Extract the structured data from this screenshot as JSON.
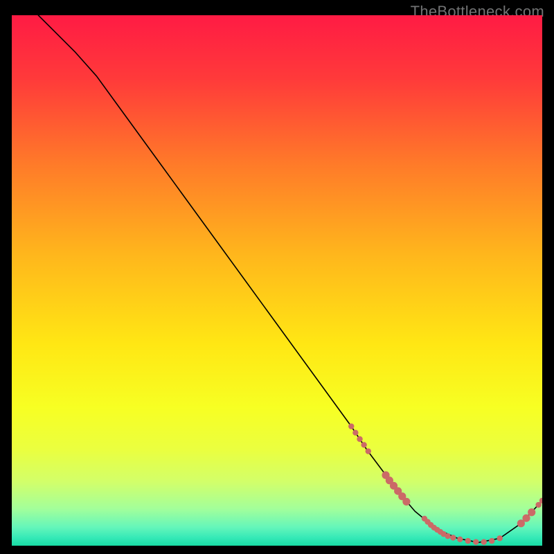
{
  "watermark": "TheBottleneck.com",
  "chart_data": {
    "type": "line",
    "title": "",
    "xlabel": "",
    "ylabel": "",
    "xlim": [
      0,
      100
    ],
    "ylim": [
      0,
      100
    ],
    "grid": false,
    "legend": false,
    "gradient_stops": [
      {
        "offset": 0.0,
        "color": "#ff1b44"
      },
      {
        "offset": 0.12,
        "color": "#ff3a3a"
      },
      {
        "offset": 0.28,
        "color": "#ff7a29"
      },
      {
        "offset": 0.45,
        "color": "#ffb61c"
      },
      {
        "offset": 0.62,
        "color": "#ffe714"
      },
      {
        "offset": 0.74,
        "color": "#f7ff23"
      },
      {
        "offset": 0.82,
        "color": "#eaff40"
      },
      {
        "offset": 0.88,
        "color": "#d2ff6a"
      },
      {
        "offset": 0.93,
        "color": "#a3ff9a"
      },
      {
        "offset": 0.965,
        "color": "#65f6ba"
      },
      {
        "offset": 0.985,
        "color": "#35e9b7"
      },
      {
        "offset": 1.0,
        "color": "#18dba4"
      }
    ],
    "series": [
      {
        "name": "bottleneck-curve",
        "color": "#000000",
        "width": 1.6,
        "x": [
          5,
          8,
          12,
          16,
          20,
          24,
          28,
          32,
          36,
          40,
          44,
          48,
          52,
          56,
          60,
          64,
          67,
          70,
          73,
          76,
          80,
          84,
          88,
          92,
          96,
          100
        ],
        "y": [
          100,
          97,
          93,
          88.5,
          83,
          77.5,
          72,
          66.5,
          61,
          55.5,
          50,
          44.5,
          39,
          33.5,
          28,
          22.5,
          18,
          14,
          10,
          6.5,
          3.2,
          1.4,
          0.6,
          1.4,
          4.2,
          8.5
        ]
      }
    ],
    "markers": {
      "name": "highlight-dots",
      "color": "#cb6a67",
      "radius_small": 4.2,
      "radius_large": 5.6,
      "points": [
        {
          "x": 64.0,
          "y": 22.5,
          "size": "small"
        },
        {
          "x": 64.8,
          "y": 21.3,
          "size": "small"
        },
        {
          "x": 65.6,
          "y": 20.1,
          "size": "small"
        },
        {
          "x": 66.4,
          "y": 19.0,
          "size": "small"
        },
        {
          "x": 67.2,
          "y": 17.8,
          "size": "small"
        },
        {
          "x": 70.5,
          "y": 13.3,
          "size": "large"
        },
        {
          "x": 71.2,
          "y": 12.3,
          "size": "large"
        },
        {
          "x": 72.0,
          "y": 11.3,
          "size": "large"
        },
        {
          "x": 72.8,
          "y": 10.3,
          "size": "large"
        },
        {
          "x": 73.6,
          "y": 9.3,
          "size": "large"
        },
        {
          "x": 74.4,
          "y": 8.3,
          "size": "large"
        },
        {
          "x": 77.8,
          "y": 5.1,
          "size": "small"
        },
        {
          "x": 78.4,
          "y": 4.5,
          "size": "small"
        },
        {
          "x": 79.0,
          "y": 3.9,
          "size": "small"
        },
        {
          "x": 79.6,
          "y": 3.4,
          "size": "small"
        },
        {
          "x": 80.2,
          "y": 3.0,
          "size": "small"
        },
        {
          "x": 80.8,
          "y": 2.6,
          "size": "small"
        },
        {
          "x": 81.4,
          "y": 2.2,
          "size": "small"
        },
        {
          "x": 82.2,
          "y": 1.8,
          "size": "small"
        },
        {
          "x": 83.2,
          "y": 1.5,
          "size": "small"
        },
        {
          "x": 84.5,
          "y": 1.2,
          "size": "small"
        },
        {
          "x": 86.0,
          "y": 0.9,
          "size": "small"
        },
        {
          "x": 87.5,
          "y": 0.7,
          "size": "small"
        },
        {
          "x": 89.0,
          "y": 0.7,
          "size": "small"
        },
        {
          "x": 90.5,
          "y": 0.9,
          "size": "small"
        },
        {
          "x": 92.0,
          "y": 1.4,
          "size": "small"
        },
        {
          "x": 96.0,
          "y": 4.2,
          "size": "large"
        },
        {
          "x": 97.0,
          "y": 5.2,
          "size": "large"
        },
        {
          "x": 98.0,
          "y": 6.3,
          "size": "large"
        },
        {
          "x": 99.3,
          "y": 7.7,
          "size": "small"
        },
        {
          "x": 100.0,
          "y": 8.5,
          "size": "small"
        }
      ]
    }
  }
}
